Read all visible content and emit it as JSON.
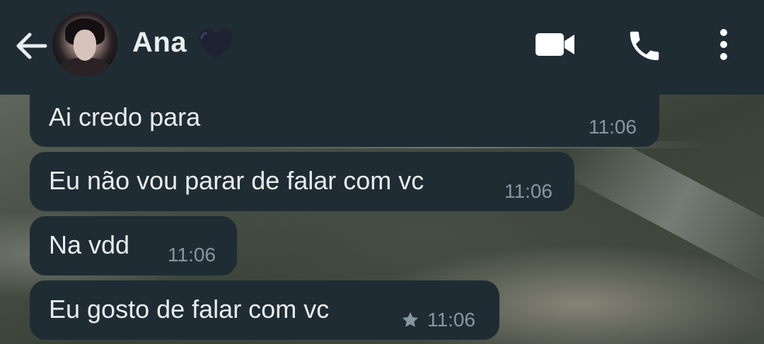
{
  "header": {
    "contact_name": "Ana",
    "heart_emoji": "💙",
    "back_icon": "arrow-left-icon",
    "video_icon": "videocam-icon",
    "call_icon": "phone-icon",
    "menu_icon": "more-vert-icon"
  },
  "messages": [
    {
      "text": "Ai credo para",
      "time": "11:06",
      "starred": false
    },
    {
      "text": "Eu não vou parar de falar com vc",
      "time": "11:06",
      "starred": false
    },
    {
      "text": "Na vdd",
      "time": "11:06",
      "starred": false
    },
    {
      "text": "Eu gosto de falar com vc",
      "time": "11:06",
      "starred": true
    }
  ],
  "colors": {
    "header_bg": "#1f2c34",
    "bubble_bg": "#1f2c34",
    "text": "#e9edef",
    "meta": "#8696a0",
    "heart": "#1e2233"
  }
}
